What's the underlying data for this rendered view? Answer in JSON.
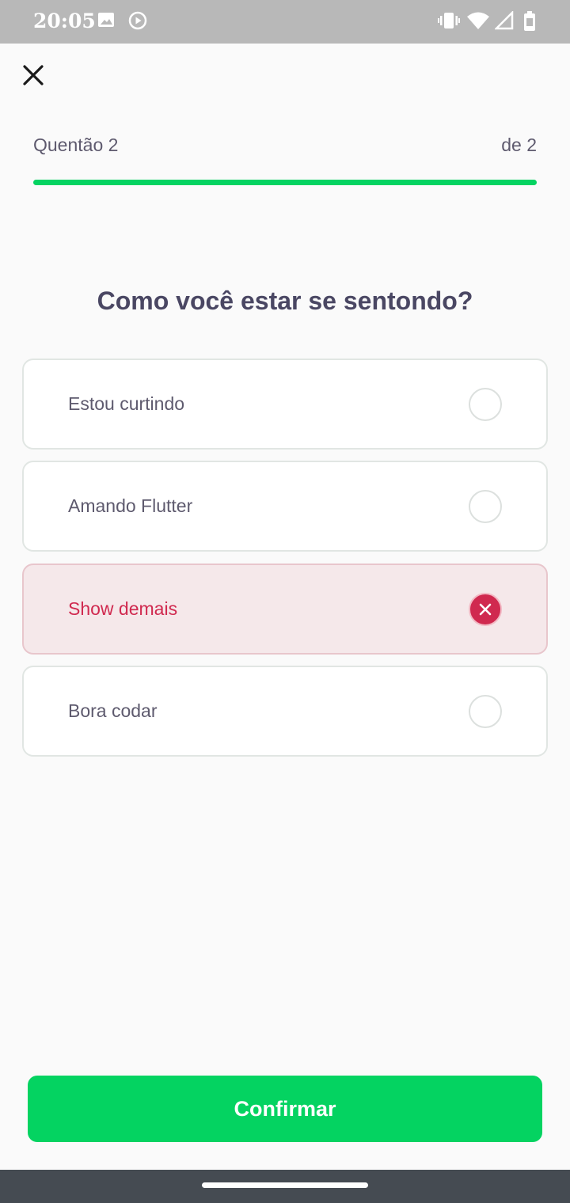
{
  "status_bar": {
    "time": "20:05",
    "icons_left": [
      "image-icon",
      "play-circle-icon"
    ],
    "icons_right": [
      "vibrate-icon",
      "wifi-icon",
      "signal-icon",
      "battery-icon"
    ]
  },
  "header": {
    "close_icon": "close-icon",
    "question_label": "Quentão 2",
    "question_total": "de 2",
    "progress": 1.0
  },
  "question": {
    "title": "Como você estar se sentondo?"
  },
  "options": [
    {
      "label": "Estou curtindo",
      "state": "unselected"
    },
    {
      "label": "Amando Flutter",
      "state": "unselected"
    },
    {
      "label": "Show demais",
      "state": "wrong"
    },
    {
      "label": "Bora codar",
      "state": "unselected"
    }
  ],
  "footer": {
    "confirm_label": "Confirmar"
  },
  "colors": {
    "accent_green": "#04D361",
    "wrong_red": "#D0294F",
    "wrong_bg": "#F5E8EA",
    "text_heading": "#4A4763",
    "text_body": "#5E5A6E",
    "status_bar_bg": "#B8B8B8",
    "nav_bar_bg": "#454B52"
  }
}
